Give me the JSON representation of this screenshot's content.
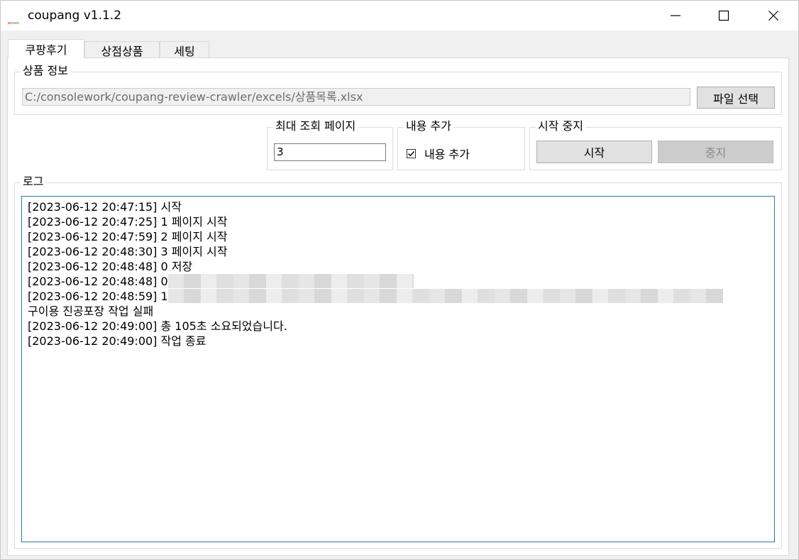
{
  "window": {
    "title": "coupang v1.1.2",
    "icon": "app-icon",
    "controls": {
      "minimize": "minimize-icon",
      "maximize": "maximize-icon",
      "close": "close-icon"
    }
  },
  "tabs": [
    {
      "label": "쿠팡후기",
      "active": true
    },
    {
      "label": "상점상품",
      "active": false
    },
    {
      "label": "세팅",
      "active": false
    }
  ],
  "product_info": {
    "legend": "상품 정보",
    "file_path": "C:/consolework/coupang-review-crawler/excels/상품목록.xlsx",
    "file_button": "파일 선택"
  },
  "max_pages": {
    "legend": "최대 조회 페이지",
    "value": "3"
  },
  "add_content": {
    "legend": "내용 추가",
    "checkbox_label": "내용 추가",
    "checked": true
  },
  "start_stop": {
    "legend": "시작 중지",
    "start_label": "시작",
    "stop_label": "중지"
  },
  "log": {
    "legend": "로그",
    "lines": [
      "[2023-06-12 20:47:15] 시작",
      "[2023-06-12 20:47:25] 1 페이지 시작",
      "[2023-06-12 20:47:59] 2 페이지 시작",
      "[2023-06-12 20:48:30] 3 페이지 시작",
      "[2023-06-12 20:48:48] 0 저장",
      "[2023-06-12 20:48:48] 0",
      "[2023-06-12 20:48:59] 1",
      "구이용 진공포장 작업 실패",
      "[2023-06-12 20:49:00] 총 105초 소요되었습니다.",
      "[2023-06-12 20:49:00] 작업 종료"
    ]
  },
  "colors": {
    "accent_border": "#2a7aa8",
    "window_bg": "#f0f0f0",
    "panel_bg": "#ffffff"
  }
}
